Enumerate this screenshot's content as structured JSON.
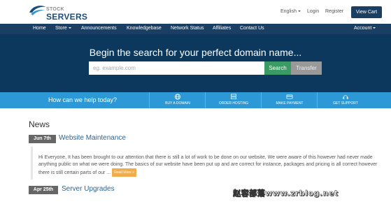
{
  "brand": {
    "line1": "STOCK",
    "line2": "SERVERS"
  },
  "topbar": {
    "language": "English",
    "login": "Login",
    "register": "Register",
    "view_cart": "View Cart"
  },
  "nav": {
    "items": [
      "Home",
      "Store",
      "Announcements",
      "Knowledgebase",
      "Network Status",
      "Affiliates",
      "Contact Us"
    ],
    "account": "Account"
  },
  "hero": {
    "title": "Begin the search for your perfect domain name...",
    "search_placeholder": "eg. example.com",
    "search_button": "Search",
    "transfer_button": "Transfer"
  },
  "help": {
    "prompt": "How can we help today?",
    "items": [
      {
        "label": "BUY A DOMAIN",
        "icon": "globe-icon"
      },
      {
        "label": "ORDER HOSTING",
        "icon": "server-stack-icon"
      },
      {
        "label": "MAKE PAYMENT",
        "icon": "credit-card-icon"
      },
      {
        "label": "GET SUPPORT",
        "icon": "support-icon"
      }
    ]
  },
  "news": {
    "heading": "News",
    "posts": [
      {
        "date": "Jun 7th",
        "title": "Website Maintenance",
        "excerpt": "Hi Everyone, It has been brought to our attention that there is still a lot of work to be done on our website, We were aware of this however had never made anything public on what we were doing. The basics of our website have been put up and are correct for instance, packages and pricing is all correct however there is still certain parts of our ...",
        "read_more": "Read More »"
      },
      {
        "date": "Apr 25th",
        "title": "Server Upgrades"
      }
    ]
  },
  "watermark": "赵容部落www.zrblog.net",
  "colors": {
    "navbar": "#1b3f63",
    "hero": "#0b385c",
    "helpbar": "#2c98d6",
    "search_button": "#3b9b64",
    "link": "#2a6496",
    "read_more": "#f0ad4e"
  }
}
